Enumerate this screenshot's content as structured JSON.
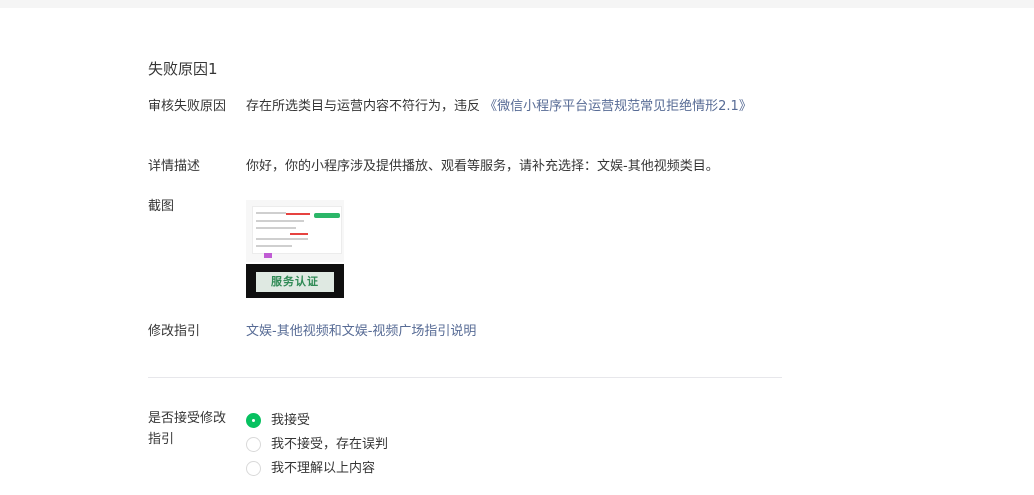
{
  "section_title": "失败原因1",
  "reason": {
    "label": "审核失败原因",
    "text": "存在所选类目与运营内容不符行为，违反 ",
    "link": "《微信小程序平台运营规范常见拒绝情形2.1》"
  },
  "detail": {
    "label": "详情描述",
    "text": "你好，你的小程序涉及提供播放、观看等服务，请补充选择：文娱-其他视频类目。"
  },
  "screenshot": {
    "label": "截图",
    "stamp_text": "服务认证"
  },
  "guide": {
    "label": "修改指引",
    "link": "文娱-其他视频和文娱-视频广场指引说明"
  },
  "accept": {
    "label": "是否接受修改指引",
    "selected": 0,
    "options": [
      "我接受",
      "我不接受，存在误判",
      "我不理解以上内容"
    ]
  },
  "colors": {
    "link": "#576b95",
    "accent": "#07c160"
  }
}
